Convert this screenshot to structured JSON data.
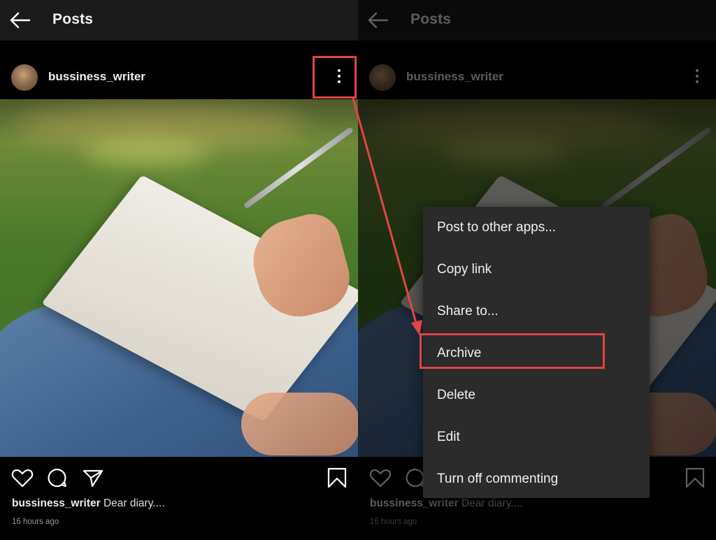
{
  "topbar": {
    "title": "Posts"
  },
  "post": {
    "username": "bussiness_writer",
    "caption_user": "bussiness_writer",
    "caption_text": " Dear diary....",
    "time": "16 hours ago"
  },
  "menu": {
    "items": [
      "Post to other apps...",
      "Copy link",
      "Share to...",
      "Archive",
      "Delete",
      "Edit",
      "Turn off commenting"
    ]
  },
  "colors": {
    "highlight": "#e04545",
    "menu_bg": "#2b2b2b",
    "topbar_bg": "#1b1b1b"
  },
  "icons": [
    "back-arrow-icon",
    "more-vertical-icon",
    "heart-icon",
    "comment-icon",
    "share-icon",
    "bookmark-icon"
  ]
}
